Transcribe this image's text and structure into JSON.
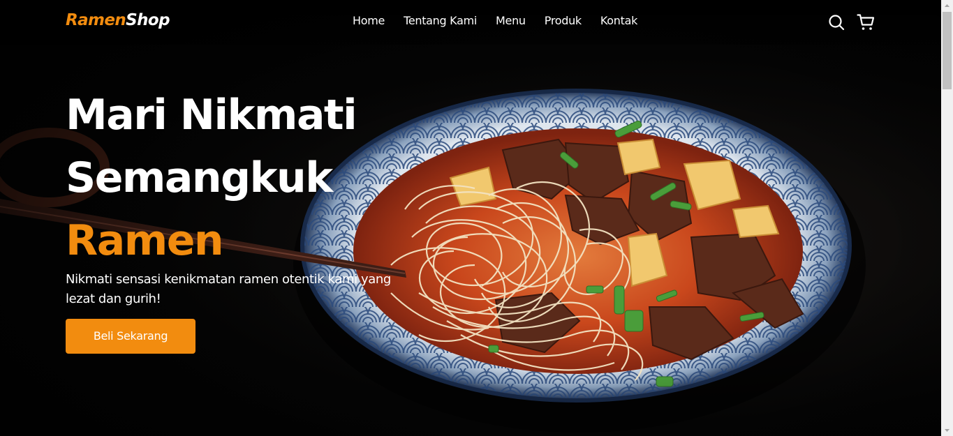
{
  "brand": {
    "logo_part1": "Ramen",
    "logo_part2": "Shop"
  },
  "nav": {
    "links": [
      {
        "label": "Home"
      },
      {
        "label": "Tentang Kami"
      },
      {
        "label": "Menu"
      },
      {
        "label": "Produk"
      },
      {
        "label": "Kontak"
      }
    ],
    "icons": [
      "search-icon",
      "shopping-cart-icon"
    ]
  },
  "hero": {
    "title_line1": "Mari Nikmati",
    "title_line2": "Semangkuk",
    "title_accent": "Ramen",
    "description": "Nikmati sensasi kenikmatan ramen otentik kami yang lezat dan gurih!",
    "cta_label": "Beli Sekarang",
    "background_image": "ramen-bowl-photo"
  },
  "colors": {
    "accent": "#f28c0f",
    "text": "#ffffff",
    "background": "#000000"
  }
}
